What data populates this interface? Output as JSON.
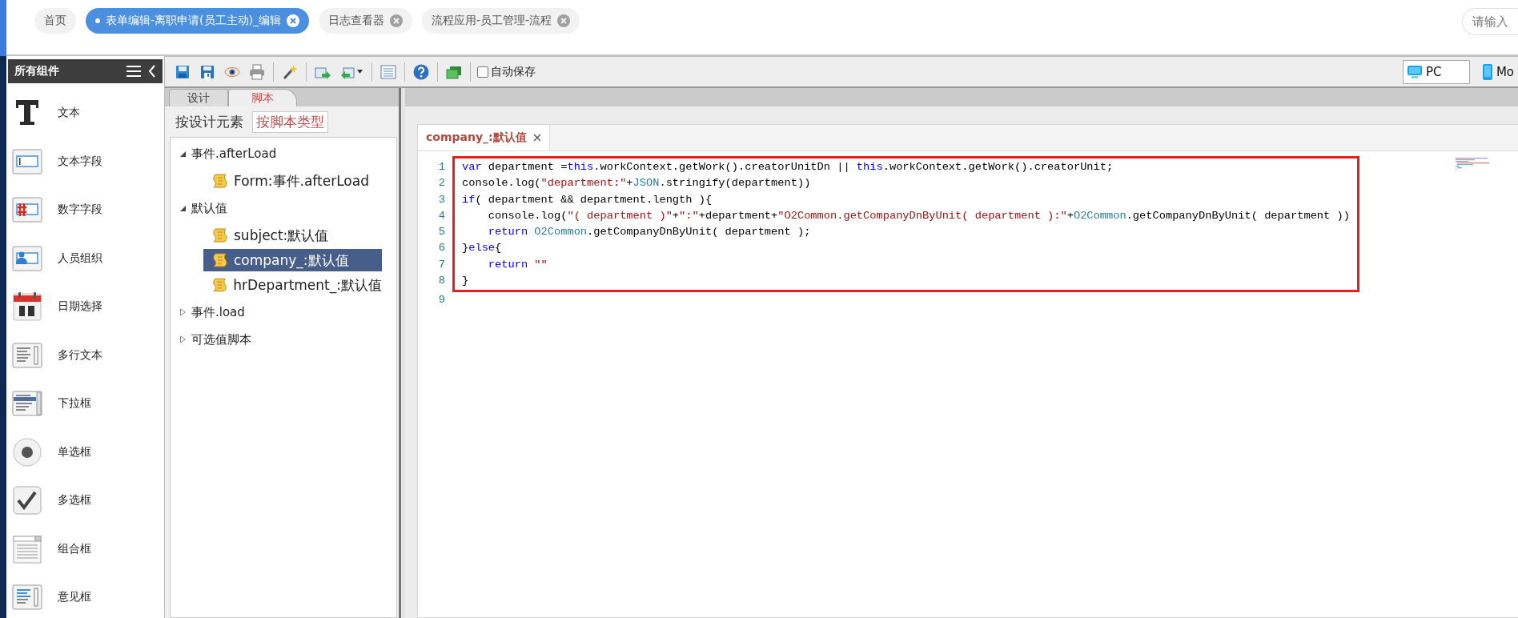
{
  "top_tabs": [
    {
      "label": "首页",
      "selected": false,
      "closable": false
    },
    {
      "label": "表单编辑-离职申请(员工主动)_编辑",
      "selected": true,
      "closable": true
    },
    {
      "label": "日志查看器",
      "selected": false,
      "closable": true
    },
    {
      "label": "流程应用-员工管理-流程",
      "selected": false,
      "closable": true
    }
  ],
  "search": {
    "placeholder": "请输入"
  },
  "sidebar": {
    "title": "所有组件",
    "items": [
      {
        "label": "文本",
        "kind": "text"
      },
      {
        "label": "文本字段",
        "kind": "textfield"
      },
      {
        "label": "数字字段",
        "kind": "number"
      },
      {
        "label": "人员组织",
        "kind": "person"
      },
      {
        "label": "日期选择",
        "kind": "date"
      },
      {
        "label": "多行文本",
        "kind": "textarea"
      },
      {
        "label": "下拉框",
        "kind": "select"
      },
      {
        "label": "单选框",
        "kind": "radio"
      },
      {
        "label": "多选框",
        "kind": "checkbox"
      },
      {
        "label": "组合框",
        "kind": "combo"
      },
      {
        "label": "意见框",
        "kind": "opinion"
      }
    ]
  },
  "toolbar": {
    "auto_save": {
      "label": "自动保存",
      "checked": false
    },
    "devices": [
      {
        "label": "PC",
        "kind": "pc",
        "selected": true
      },
      {
        "label": "Mo",
        "kind": "mobile",
        "selected": false
      }
    ]
  },
  "panel_tabs": [
    {
      "label": "设计",
      "selected": false
    },
    {
      "label": "脚本",
      "selected": true
    }
  ],
  "view_tabs": [
    {
      "label": "按设计元素",
      "selected": false
    },
    {
      "label": "按脚本类型",
      "selected": true
    }
  ],
  "tree": [
    {
      "label": "事件.afterLoad",
      "expanded": true,
      "selected": false,
      "children": [
        {
          "label": "Form:事件.afterLoad",
          "selected": false
        }
      ]
    },
    {
      "label": "默认值",
      "expanded": true,
      "selected": false,
      "children": [
        {
          "label": "subject:默认值",
          "selected": false
        },
        {
          "label": "company_:默认值",
          "selected": true
        },
        {
          "label": "hrDepartment_:默认值",
          "selected": false
        }
      ]
    },
    {
      "label": "事件.load",
      "expanded": false,
      "selected": false
    },
    {
      "label": "可选值脚本",
      "expanded": false,
      "selected": false
    }
  ],
  "editor": {
    "tab": {
      "title": "company_:默认值"
    },
    "lines": [
      {
        "number": "1",
        "highlighted": true,
        "tokens": [
          {
            "text": "var",
            "kind": "keyword"
          },
          {
            "text": " department =",
            "kind": "plain"
          },
          {
            "text": "this",
            "kind": "keyword"
          },
          {
            "text": ".workContext.getWork().creatorUnitDn || ",
            "kind": "plain"
          },
          {
            "text": "this",
            "kind": "keyword"
          },
          {
            "text": ".workContext.getWork().creatorUnit;",
            "kind": "plain"
          }
        ]
      },
      {
        "number": "2",
        "highlighted": true,
        "tokens": [
          {
            "text": "console.log(",
            "kind": "plain"
          },
          {
            "text": "\"department:\"",
            "kind": "string"
          },
          {
            "text": "+",
            "kind": "plain"
          },
          {
            "text": "JSON",
            "kind": "type"
          },
          {
            "text": ".stringify(department))",
            "kind": "plain"
          }
        ]
      },
      {
        "number": "3",
        "highlighted": true,
        "tokens": [
          {
            "text": "if",
            "kind": "keyword"
          },
          {
            "text": "( department && department.length ){",
            "kind": "plain"
          }
        ]
      },
      {
        "number": "4",
        "highlighted": true,
        "tokens": [
          {
            "text": "    console.log(",
            "kind": "plain"
          },
          {
            "text": "\"( department )\"",
            "kind": "string"
          },
          {
            "text": "+",
            "kind": "plain"
          },
          {
            "text": "\":\"",
            "kind": "string"
          },
          {
            "text": "+department+",
            "kind": "plain"
          },
          {
            "text": "\"O2Common.getCompanyDnByUnit( department ):\"",
            "kind": "string"
          },
          {
            "text": "+",
            "kind": "plain"
          },
          {
            "text": "O2Common",
            "kind": "type"
          },
          {
            "text": ".getCompanyDnByUnit( department ))",
            "kind": "plain"
          }
        ]
      },
      {
        "number": "5",
        "highlighted": true,
        "tokens": [
          {
            "text": "    return",
            "kind": "keyword"
          },
          {
            "text": " O2Common",
            "kind": "type"
          },
          {
            "text": ".getCompanyDnByUnit( department );",
            "kind": "plain"
          }
        ]
      },
      {
        "number": "6",
        "highlighted": true,
        "tokens": [
          {
            "text": "}",
            "kind": "plain"
          },
          {
            "text": "else",
            "kind": "keyword"
          },
          {
            "text": "{",
            "kind": "plain"
          }
        ]
      },
      {
        "number": "7",
        "highlighted": true,
        "tokens": [
          {
            "text": "    return",
            "kind": "keyword"
          },
          {
            "text": " \"\"",
            "kind": "string"
          }
        ]
      },
      {
        "number": "8",
        "highlighted": true,
        "tokens": [
          {
            "text": "}",
            "kind": "plain"
          }
        ]
      },
      {
        "number": "9",
        "highlighted": false
      }
    ]
  }
}
